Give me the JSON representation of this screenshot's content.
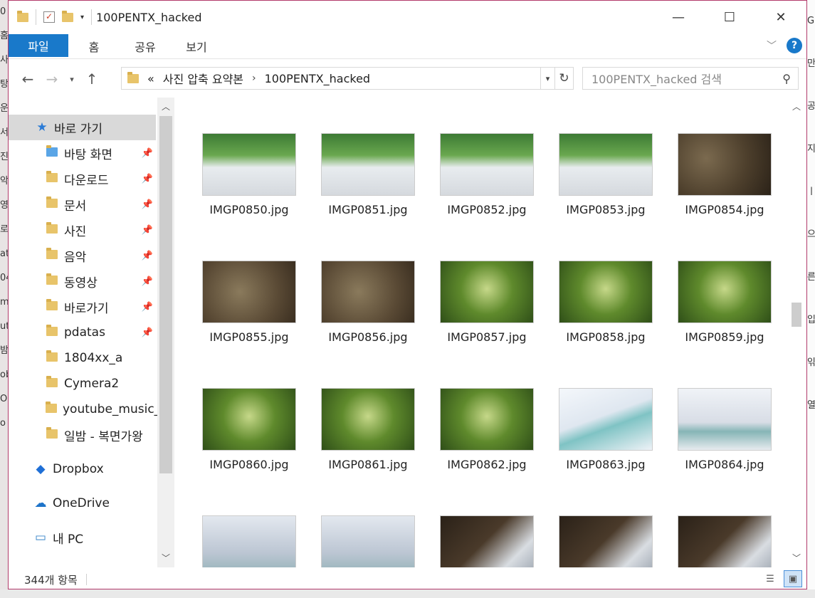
{
  "window": {
    "title": "100PENTX_hacked",
    "controls": {
      "minimize": "—",
      "maximize": "☐",
      "close": "✕"
    }
  },
  "ribbon": {
    "file_tab": "파일",
    "tabs": [
      "홈",
      "공유",
      "보기"
    ],
    "help": "?"
  },
  "address": {
    "overflow": "«",
    "crumbs": [
      "사진 압축 요약본",
      "100PENTX_hacked"
    ]
  },
  "search": {
    "placeholder": "100PENTX_hacked 검색"
  },
  "nav": {
    "quick_access": "바로 가기",
    "items": [
      {
        "label": "바탕 화면",
        "pinned": true
      },
      {
        "label": "다운로드",
        "pinned": true
      },
      {
        "label": "문서",
        "pinned": true
      },
      {
        "label": "사진",
        "pinned": true
      },
      {
        "label": "음악",
        "pinned": true
      },
      {
        "label": "동영상",
        "pinned": true
      },
      {
        "label": "바로가기",
        "pinned": true
      },
      {
        "label": "pdatas",
        "pinned": true
      },
      {
        "label": "1804xx_a",
        "pinned": false
      },
      {
        "label": "Cymera2",
        "pinned": false
      },
      {
        "label": "youtube_music_",
        "pinned": false
      },
      {
        "label": "일밤 - 복면가왕",
        "pinned": false
      }
    ],
    "dropbox": "Dropbox",
    "onedrive": "OneDrive",
    "thispc": "내 PC"
  },
  "files": [
    {
      "name": "IMGP0850.jpg",
      "thumb": "street"
    },
    {
      "name": "IMGP0851.jpg",
      "thumb": "street"
    },
    {
      "name": "IMGP0852.jpg",
      "thumb": "street"
    },
    {
      "name": "IMGP0853.jpg",
      "thumb": "street"
    },
    {
      "name": "IMGP0854.jpg",
      "thumb": "soil"
    },
    {
      "name": "IMGP0855.jpg",
      "thumb": "soil-light"
    },
    {
      "name": "IMGP0856.jpg",
      "thumb": "soil-light"
    },
    {
      "name": "IMGP0857.jpg",
      "thumb": "plant"
    },
    {
      "name": "IMGP0858.jpg",
      "thumb": "plant"
    },
    {
      "name": "IMGP0859.jpg",
      "thumb": "plant"
    },
    {
      "name": "IMGP0860.jpg",
      "thumb": "plant"
    },
    {
      "name": "IMGP0861.jpg",
      "thumb": "plant"
    },
    {
      "name": "IMGP0862.jpg",
      "thumb": "plant"
    },
    {
      "name": "IMGP0863.jpg",
      "thumb": "fabric"
    },
    {
      "name": "IMGP0864.jpg",
      "thumb": "fabric2"
    },
    {
      "name": "",
      "thumb": "shirt"
    },
    {
      "name": "",
      "thumb": "shirt"
    },
    {
      "name": "",
      "thumb": "dark"
    },
    {
      "name": "",
      "thumb": "dark"
    },
    {
      "name": "",
      "thumb": "dark"
    }
  ],
  "status": {
    "item_count": "344개 항목"
  }
}
